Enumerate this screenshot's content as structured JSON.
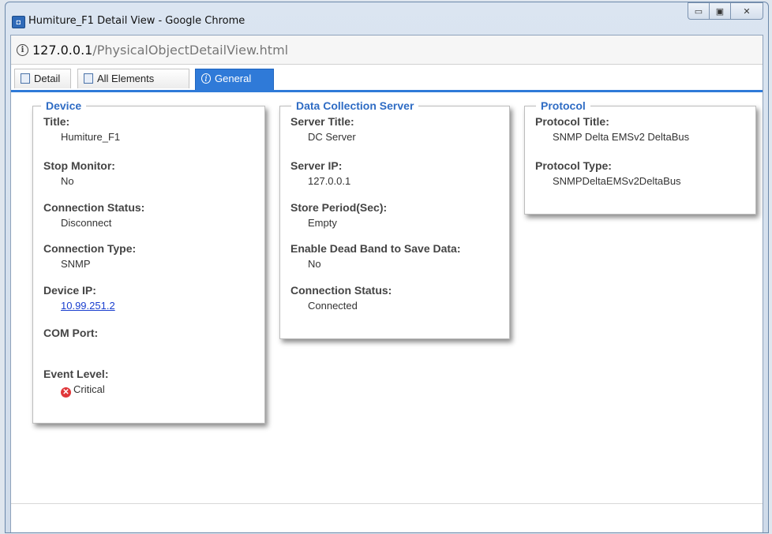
{
  "window": {
    "title": "Humiture_F1 Detail View - Google Chrome",
    "buttons": {
      "minimize": "▭",
      "maximize": "▣",
      "close": "✕"
    }
  },
  "address": {
    "host": "127.0.0.1",
    "path": "/PhysicalObjectDetailView.html"
  },
  "tabs": [
    {
      "label": "Detail",
      "icon": "detail-icon"
    },
    {
      "label": "All Elements",
      "icon": "document-icon"
    },
    {
      "label": "General",
      "icon": "info-icon",
      "active": true
    }
  ],
  "device": {
    "legend": "Device",
    "fields": [
      {
        "label": "Title:",
        "value": "Humiture_F1"
      },
      {
        "label": "Stop Monitor:",
        "value": "No"
      },
      {
        "label": "Connection Status:",
        "value": "Disconnect"
      },
      {
        "label": "Connection Type:",
        "value": "SNMP"
      },
      {
        "label": "Device IP:",
        "value": "10.99.251.2"
      },
      {
        "label": "COM Port:",
        "value": ""
      },
      {
        "label": "Event Level:",
        "value": "Critical"
      }
    ]
  },
  "server": {
    "legend": "Data Collection Server",
    "fields": [
      {
        "label": "Server Title:",
        "value": "DC Server"
      },
      {
        "label": "Server IP:",
        "value": "127.0.0.1"
      },
      {
        "label": "Store Period(Sec):",
        "value": "Empty"
      },
      {
        "label": "Enable Dead Band to Save Data:",
        "value": "No"
      },
      {
        "label": "Connection Status:",
        "value": "Connected"
      }
    ]
  },
  "protocol": {
    "legend": "Protocol",
    "fields": [
      {
        "label": "Protocol Title:",
        "value": "SNMP Delta EMSv2 DeltaBus"
      },
      {
        "label": "Protocol Type:",
        "value": "SNMPDeltaEMSv2DeltaBus"
      }
    ]
  },
  "colors": {
    "accent": "#2f7ad8",
    "legend": "#2f6cc4",
    "critical": "#e0373a",
    "link": "#1a3fcf"
  }
}
